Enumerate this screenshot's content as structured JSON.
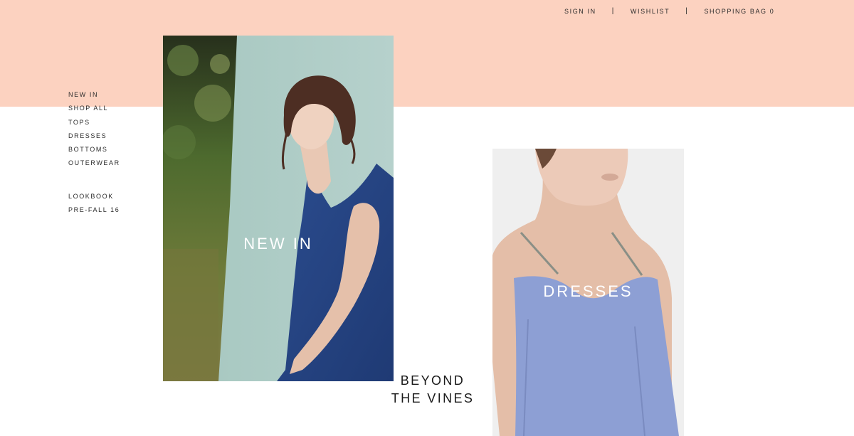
{
  "header": {
    "sign_in": "SIGN IN",
    "wishlist": "WISHLIST",
    "shopping_bag": "SHOPPING BAG 0",
    "separator": "|"
  },
  "sidebar": {
    "shop_items": [
      {
        "label": "NEW IN"
      },
      {
        "label": "SHOP ALL"
      },
      {
        "label": "TOPS"
      },
      {
        "label": "DRESSES"
      },
      {
        "label": "BOTTOMS"
      },
      {
        "label": "OUTERWEAR"
      }
    ],
    "editorial_items": [
      {
        "label": "LOOKBOOK"
      },
      {
        "label": "PRE-FALL 16"
      }
    ]
  },
  "tiles": {
    "new_in": {
      "label": "NEW IN"
    },
    "dresses": {
      "label": "DRESSES"
    }
  },
  "feature": {
    "line1": "BEYOND",
    "line2": "THE VINES"
  },
  "colors": {
    "peach": "#fcd2c0",
    "navy_top": "#2f4f91",
    "slip_blue": "#8d9fd4"
  }
}
